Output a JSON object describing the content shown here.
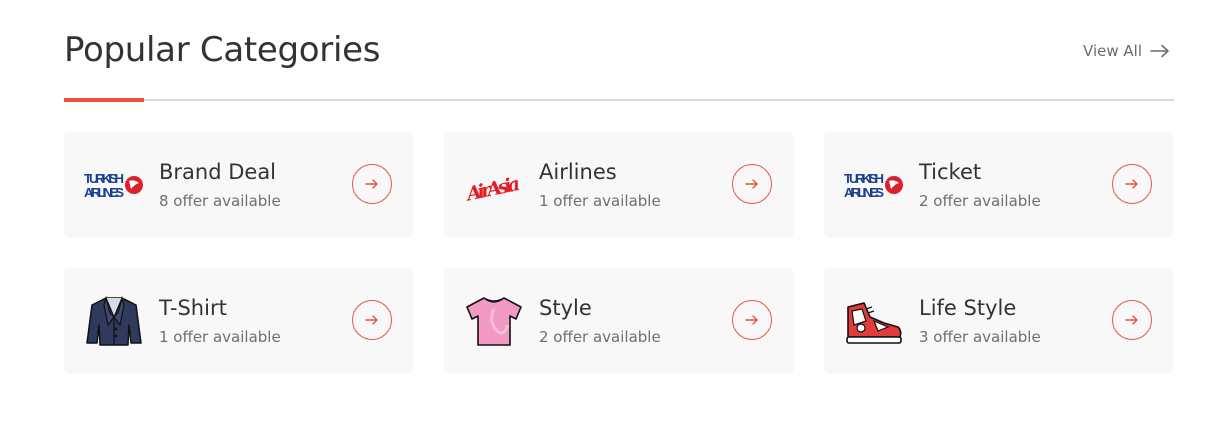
{
  "header": {
    "title": "Popular Categories",
    "view_all_label": "View All",
    "view_all_icon": "arrow-right-icon"
  },
  "colors": {
    "accent": "#e8543e",
    "card_bg": "#f8f8f8",
    "text_dark": "#333333",
    "text_muted": "#6f6f6f"
  },
  "categories": [
    {
      "name": "Brand Deal",
      "count": "8 offer available",
      "logo": "turkish-airlines-logo"
    },
    {
      "name": "Airlines",
      "count": "1 offer available",
      "logo": "airasia-logo"
    },
    {
      "name": "Ticket",
      "count": "2 offer available",
      "logo": "turkish-airlines-logo"
    },
    {
      "name": "T-Shirt",
      "count": "1 offer available",
      "logo": "blazer-icon"
    },
    {
      "name": "Style",
      "count": "2 offer available",
      "logo": "tshirt-icon"
    },
    {
      "name": "Life Style",
      "count": "3 offer available",
      "logo": "sneaker-icon"
    }
  ],
  "logo_text": {
    "turkish_line1": "TURKISH",
    "turkish_line2": "AIRLINES",
    "airasia": "AirAsia"
  }
}
